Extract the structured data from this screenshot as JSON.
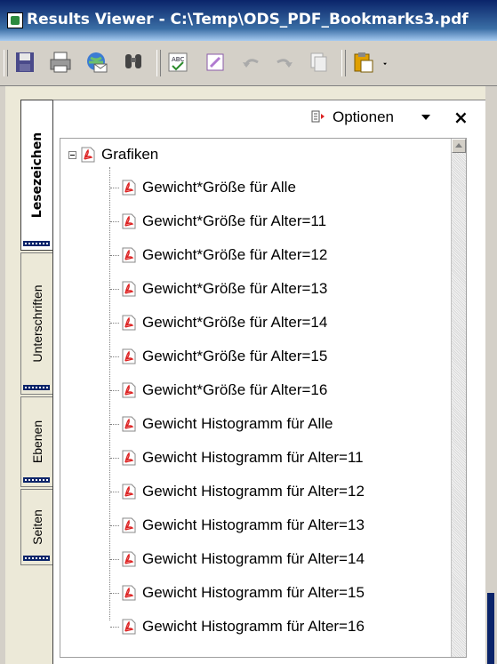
{
  "window": {
    "title": "Results Viewer - C:\\Temp\\ODS_PDF_Bookmarks3.pdf"
  },
  "toolbar": {
    "buttons": [
      {
        "name": "save-icon",
        "icon": "floppy-disk"
      },
      {
        "name": "print-icon",
        "icon": "printer"
      },
      {
        "name": "email-icon",
        "icon": "globe-envelope"
      },
      {
        "name": "find-icon",
        "icon": "binoculars"
      },
      {
        "name": "spellcheck-icon",
        "icon": "abc-check"
      },
      {
        "name": "edit-icon",
        "icon": "pencil-doc"
      },
      {
        "name": "undo-icon",
        "icon": "undo-arrow"
      },
      {
        "name": "redo-icon",
        "icon": "redo-arrow"
      },
      {
        "name": "copy-icon",
        "icon": "copy-pages"
      },
      {
        "name": "paste-icon",
        "icon": "clipboard"
      }
    ]
  },
  "side_tabs": [
    {
      "label": "Lesezeichen",
      "active": true
    },
    {
      "label": "Unterschriften",
      "active": false
    },
    {
      "label": "Ebenen",
      "active": false
    },
    {
      "label": "Seiten",
      "active": false
    }
  ],
  "panel": {
    "options_label": "Optionen",
    "close_label": "×"
  },
  "bookmarks": {
    "root_label": "Grafiken",
    "children": [
      "Gewicht*Größe für Alle",
      "Gewicht*Größe für Alter=11",
      "Gewicht*Größe für Alter=12",
      "Gewicht*Größe für Alter=13",
      "Gewicht*Größe für Alter=14",
      "Gewicht*Größe für Alter=15",
      "Gewicht*Größe für Alter=16",
      "Gewicht Histogramm für Alle",
      "Gewicht Histogramm für Alter=11",
      "Gewicht Histogramm für Alter=12",
      "Gewicht Histogramm für Alter=13",
      "Gewicht Histogramm für Alter=14",
      "Gewicht Histogramm für Alter=15",
      "Gewicht Histogramm für Alter=16"
    ]
  },
  "colors": {
    "titlebar": "#0a246a",
    "pdf_red": "#d22",
    "window_bg": "#d4d0c8"
  }
}
